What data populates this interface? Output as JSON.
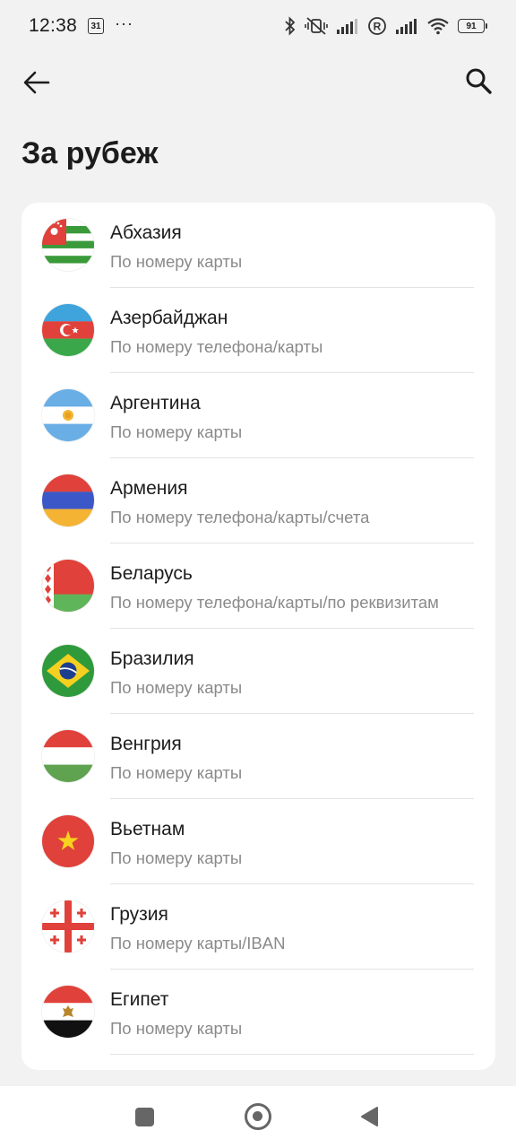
{
  "status_bar": {
    "time": "12:38",
    "calendar_day": "31",
    "more": "···",
    "battery": "91"
  },
  "title": "За рубеж",
  "countries": [
    {
      "name": "Абхазия",
      "method": "По номеру карты",
      "flag": "abkhazia-flag-icon"
    },
    {
      "name": "Азербайджан",
      "method": "По номеру телефона/карты",
      "flag": "azerbaijan-flag-icon"
    },
    {
      "name": "Аргентина",
      "method": "По номеру карты",
      "flag": "argentina-flag-icon"
    },
    {
      "name": "Армения",
      "method": "По номеру телефона/карты/счета",
      "flag": "armenia-flag-icon"
    },
    {
      "name": "Беларусь",
      "method": "По номеру телефона/карты/по реквизитам",
      "flag": "belarus-flag-icon"
    },
    {
      "name": "Бразилия",
      "method": "По номеру карты",
      "flag": "brazil-flag-icon"
    },
    {
      "name": "Венгрия",
      "method": "По номеру карты",
      "flag": "hungary-flag-icon"
    },
    {
      "name": "Вьетнам",
      "method": "По номеру карты",
      "flag": "vietnam-flag-icon"
    },
    {
      "name": "Грузия",
      "method": "По номеру карты/IBAN",
      "flag": "georgia-flag-icon"
    },
    {
      "name": "Египет",
      "method": "По номеру карты",
      "flag": "egypt-flag-icon"
    }
  ],
  "icons": {
    "back": "arrow-left-icon",
    "search": "search-icon",
    "nav_recents": "square-icon",
    "nav_home": "circle-icon",
    "nav_back": "triangle-back-icon"
  },
  "colors": {
    "background": "#f2f2f2",
    "card": "#ffffff",
    "secondary_text": "#8a8a8a"
  }
}
